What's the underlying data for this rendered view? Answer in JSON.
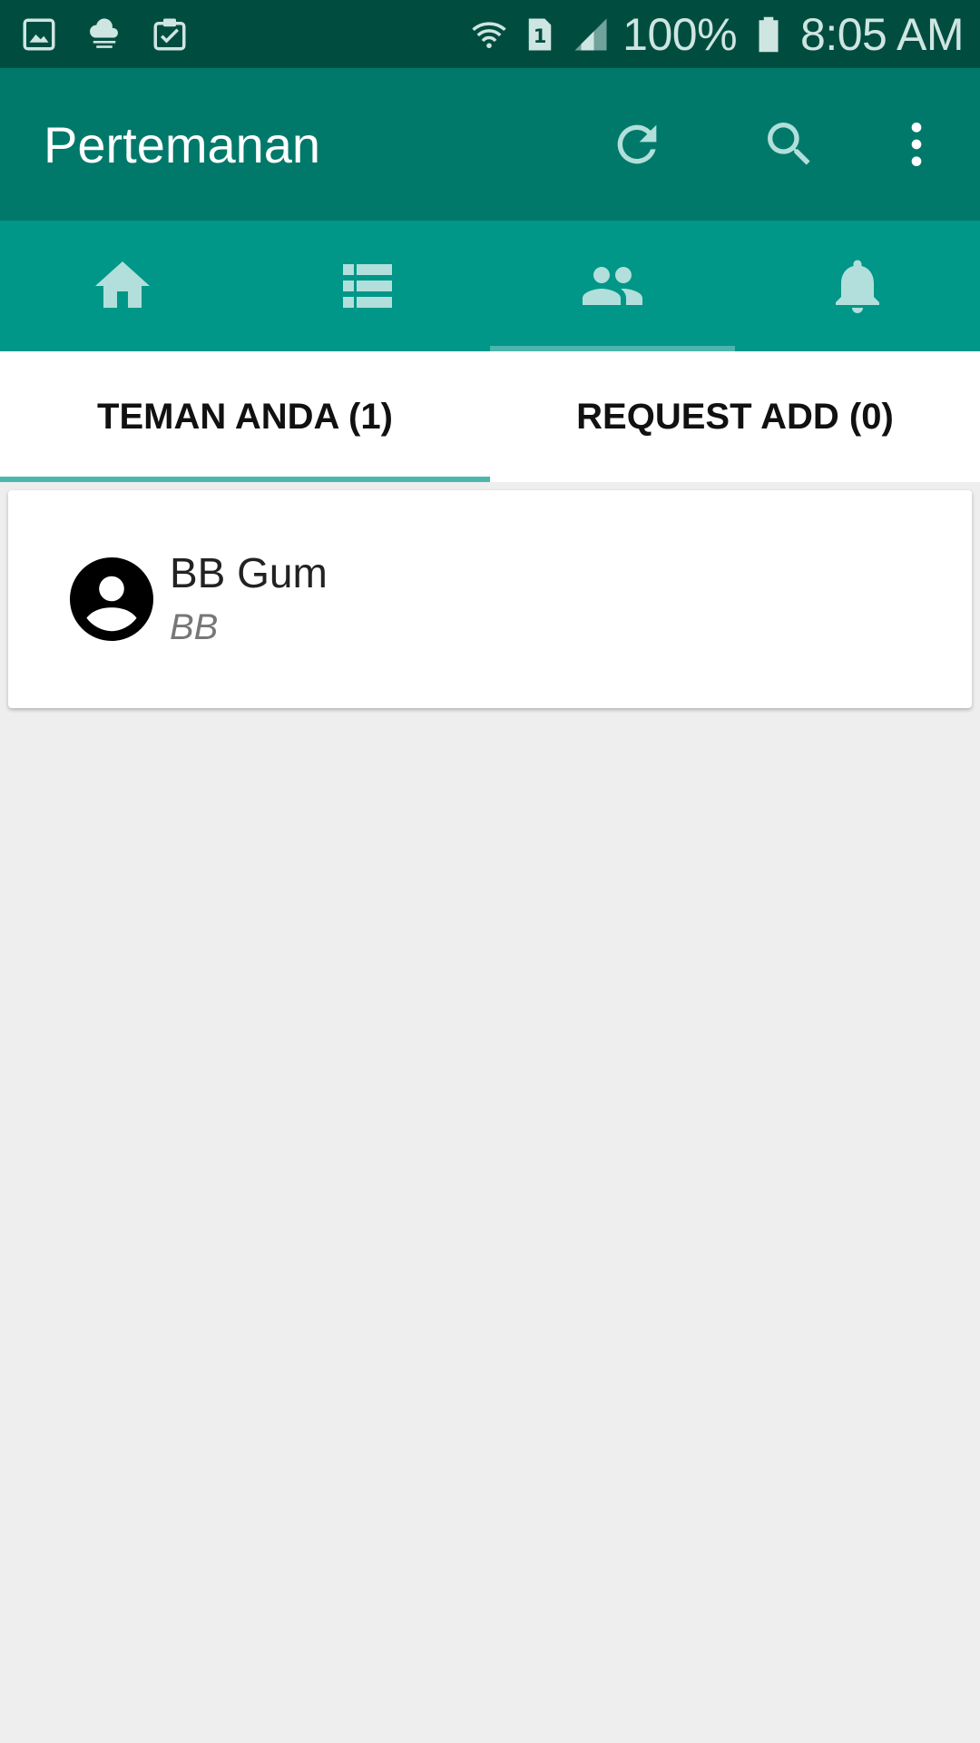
{
  "status_bar": {
    "icons": [
      "gallery-icon",
      "cloud-icon",
      "clipboard-check-icon",
      "wifi-icon",
      "sim-1-icon",
      "signal-icon",
      "battery-icon"
    ],
    "battery": "100%",
    "time": "8:05 AM"
  },
  "toolbar": {
    "title": "Pertemanan",
    "actions": [
      "refresh-icon",
      "search-icon",
      "more-vert-icon"
    ]
  },
  "nav_tabs": [
    {
      "icon": "home-icon",
      "active": false
    },
    {
      "icon": "list-icon",
      "active": false
    },
    {
      "icon": "people-icon",
      "active": true
    },
    {
      "icon": "bell-icon",
      "active": false
    }
  ],
  "sub_tabs": [
    {
      "label": "TEMAN ANDA (1)",
      "active": true
    },
    {
      "label": "REQUEST ADD (0)",
      "active": false
    }
  ],
  "friends": [
    {
      "name": "BB Gum",
      "subtitle": "BB",
      "icon": "account-circle-icon"
    }
  ],
  "colors": {
    "status_bar": "#004d40",
    "toolbar": "#00796b",
    "nav_tabs": "#009688",
    "indicator": "#4db6ac",
    "background": "#eeeeee"
  }
}
